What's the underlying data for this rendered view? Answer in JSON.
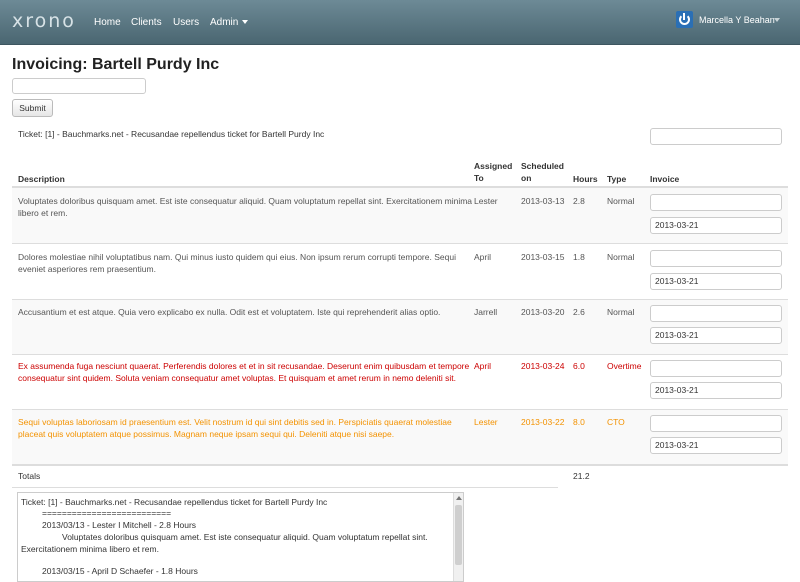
{
  "nav": {
    "brand": "xrono",
    "links": [
      "Home",
      "Clients",
      "Users",
      "Admin"
    ],
    "user": "Marcella Y Beahan"
  },
  "page": {
    "title": "Invoicing: Bartell Purdy Inc",
    "search_value": "",
    "submit_label": "Submit"
  },
  "ticket": {
    "heading": "Ticket: [1] - Bauchmarks.net - Recusandae repellendus ticket for Bartell Purdy Inc",
    "invoice_value": ""
  },
  "table": {
    "headers": {
      "description": "Description",
      "assigned": "Assigned To",
      "scheduled": "Scheduled on",
      "hours": "Hours",
      "type": "Type",
      "invoice": "Invoice"
    },
    "rows": [
      {
        "description": "Voluptates doloribus quisquam amet. Est iste consequatur aliquid. Quam voluptatum repellat sint. Exercitationem minima libero et rem.",
        "assigned": "Lester",
        "scheduled": "2013-03-13",
        "hours": "2.8",
        "type": "Normal",
        "invoice": "",
        "invoice_date": "2013-03-21"
      },
      {
        "description": "Dolores molestiae nihil voluptatibus nam. Qui minus iusto quidem qui eius. Non ipsum rerum corrupti tempore. Sequi eveniet asperiores rem praesentium.",
        "assigned": "April",
        "scheduled": "2013-03-15",
        "hours": "1.8",
        "type": "Normal",
        "invoice": "",
        "invoice_date": "2013-03-21"
      },
      {
        "description": "Accusantium et est atque. Quia vero explicabo ex nulla. Odit est et voluptatem. Iste qui reprehenderit alias optio.",
        "assigned": "Jarrell",
        "scheduled": "2013-03-20",
        "hours": "2.6",
        "type": "Normal",
        "invoice": "",
        "invoice_date": "2013-03-21"
      },
      {
        "description": "Ex assumenda fuga nesciunt quaerat. Perferendis dolores et et in sit recusandae. Deserunt enim quibusdam et tempore consequatur sint quidem. Soluta veniam consequatur amet voluptas. Et quisquam et amet rerum in nemo deleniti sit.",
        "assigned": "April",
        "scheduled": "2013-03-24",
        "hours": "6.0",
        "type": "Overtime",
        "invoice": "",
        "invoice_date": "2013-03-21"
      },
      {
        "description": "Sequi voluptas laboriosam id praesentium est. Velit nostrum id qui sint debitis sed in. Perspiciatis quaerat molestiae placeat quis voluptatem atque possimus. Magnam neque ipsam sequi qui. Deleniti atque nisi saepe.",
        "assigned": "Lester",
        "scheduled": "2013-03-22",
        "hours": "8.0",
        "type": "CTO",
        "invoice": "",
        "invoice_date": "2013-03-21"
      }
    ],
    "totals_label": "Totals",
    "totals_hours": "21.2"
  },
  "summary": {
    "lines": [
      "Ticket: [1] - Bauchmarks.net - Recusandae repellendus ticket for Bartell Purdy Inc",
      "==========================",
      "2013/03/13 - Lester I Mitchell - 2.8 Hours",
      "Voluptates doloribus quisquam amet. Est iste consequatur aliquid. Quam voluptatum repellat sint.",
      "Exercitationem minima libero et rem.",
      "",
      "2013/03/15 - April D Schaefer - 1.8 Hours"
    ]
  },
  "colors": {
    "normal": "#555555",
    "overtime": "#cc0000",
    "cto": "#f39200",
    "navbar": "#5a7683"
  }
}
